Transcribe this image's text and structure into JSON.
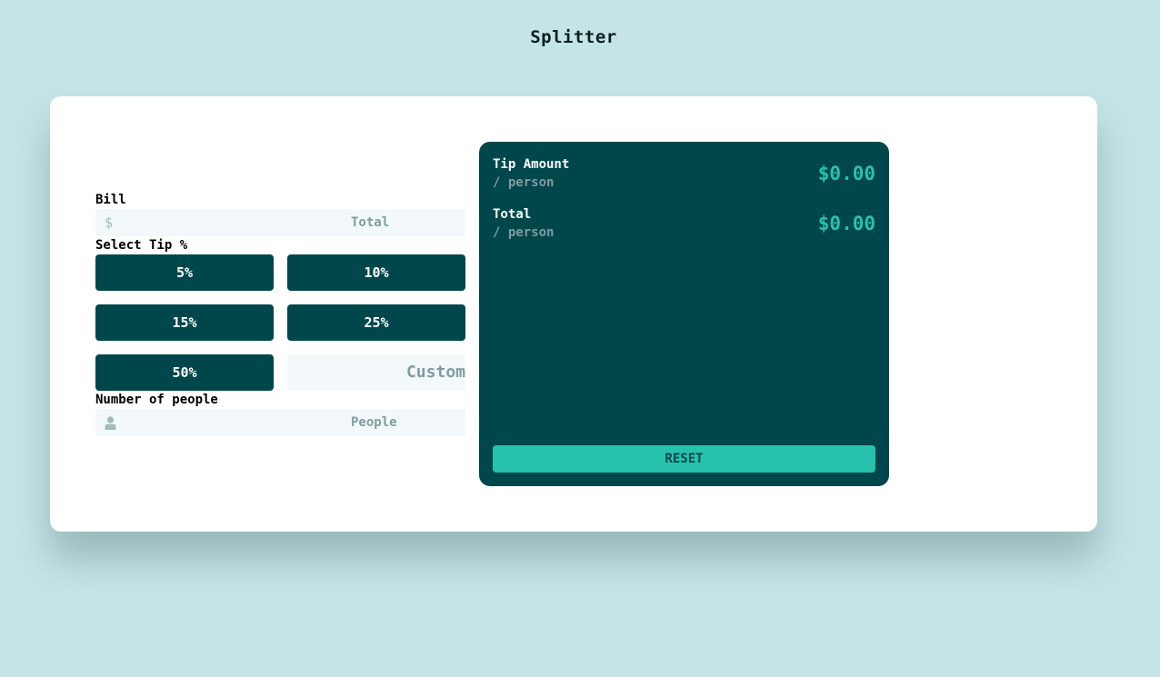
{
  "app": {
    "title": "Splitter"
  },
  "bill": {
    "label": "Bill",
    "currency_symbol": "$",
    "placeholder": "Total"
  },
  "tip": {
    "label": "Select Tip %",
    "options": [
      "5%",
      "10%",
      "15%",
      "25%",
      "50%"
    ],
    "custom_placeholder": "Custom"
  },
  "people": {
    "label": "Number of people",
    "placeholder": "People",
    "icon": "person-icon"
  },
  "results": {
    "tip_amount_label": "Tip Amount",
    "tip_amount_sub": "/ person",
    "tip_amount_value": "$0.00",
    "total_label": "Total",
    "total_sub": "/ person",
    "total_value": "$0.00",
    "reset_label": "RESET"
  },
  "colors": {
    "background": "#c5e4e7",
    "dark_cyan": "#00474b",
    "strong_cyan": "#26c2ad",
    "input_bg": "#f3f8fb",
    "grayish_cyan": "#7f9d9f"
  }
}
